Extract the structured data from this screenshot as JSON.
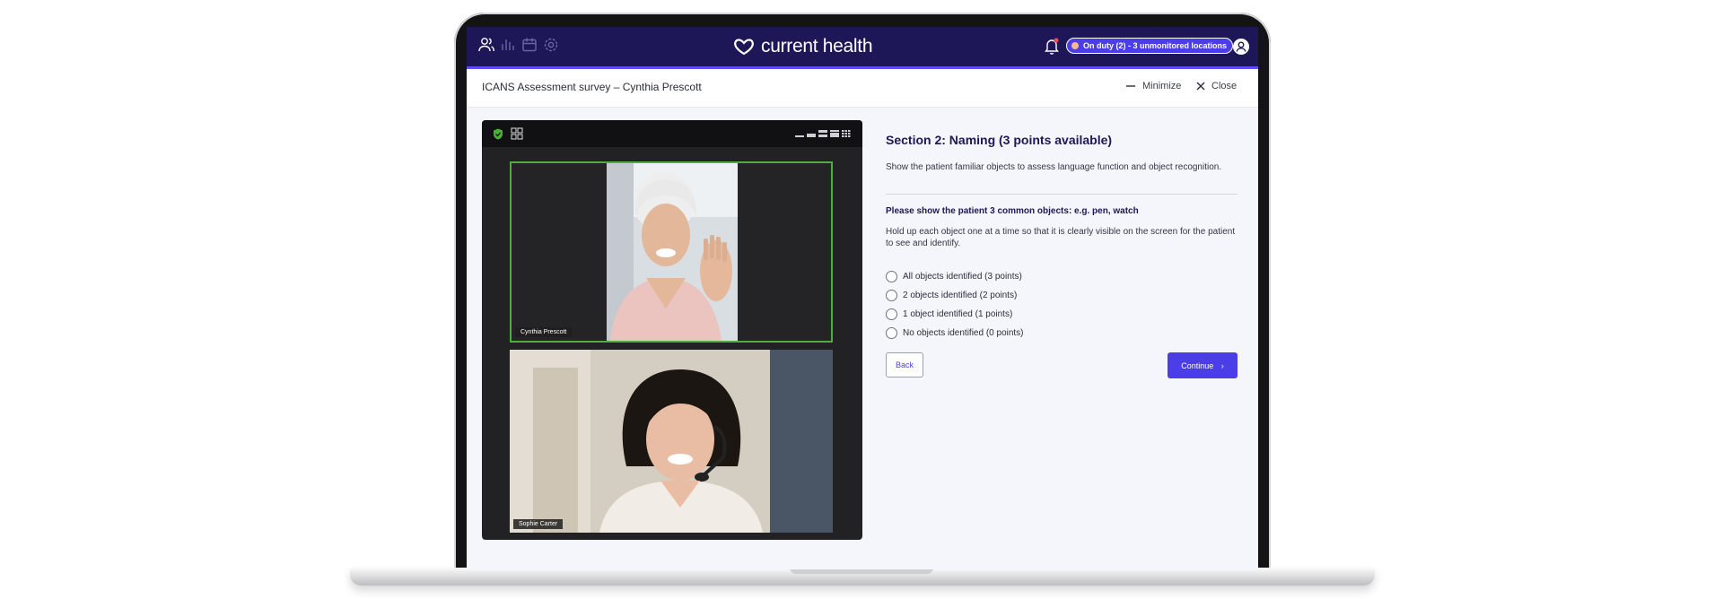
{
  "app": {
    "brand": "current health",
    "duty_badge": "On duty (2) - 3 unmonitored locations"
  },
  "nav": {
    "icons": [
      "users-icon",
      "chart-icon",
      "calendar-icon",
      "settings-icon"
    ]
  },
  "modal": {
    "title": "ICANS Assessment survey – Cynthia Prescott",
    "minimize_label": "Minimize",
    "close_label": "Close"
  },
  "video": {
    "participants": [
      {
        "name": "Cynthia Prescott"
      },
      {
        "name": "Sophie Carter"
      }
    ]
  },
  "form": {
    "section_title": "Section 2: Naming (3 points available)",
    "section_description": "Show the patient familiar objects to assess language function and object recognition.",
    "question_title": "Please show the patient 3 common objects: e.g. pen, watch",
    "question_description": "Hold up each object one at a time so that it is clearly visible on the screen for the patient to see and identify.",
    "options": [
      {
        "label": "All objects identified (3 points)"
      },
      {
        "label": "2 objects identified (2 points)"
      },
      {
        "label": "1 object identified (1 points)"
      },
      {
        "label": "No objects identified (0 points)"
      }
    ],
    "back_label": "Back",
    "continue_label": "Continue"
  },
  "colors": {
    "nav": "#1d1758",
    "accent": "#4b3ee8",
    "active_speaker": "#4caf3c"
  }
}
